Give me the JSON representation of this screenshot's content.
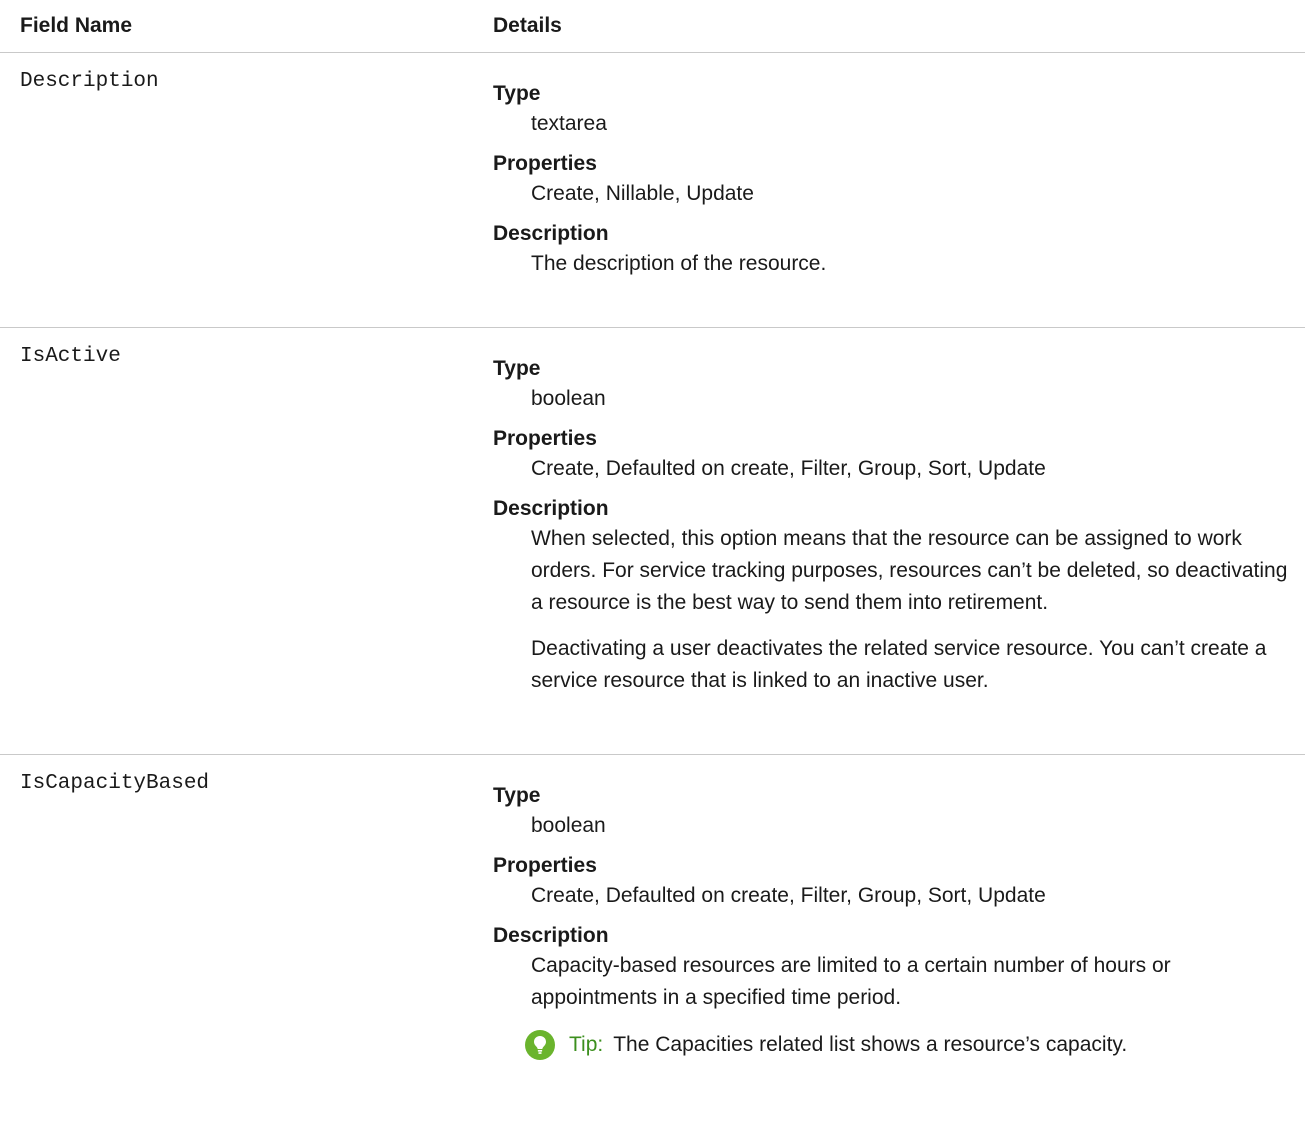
{
  "header": {
    "field_name": "Field Name",
    "details": "Details"
  },
  "rows": [
    {
      "name": "Description",
      "type_label": "Type",
      "type": "textarea",
      "properties_label": "Properties",
      "properties": "Create, Nillable, Update",
      "description_label": "Description",
      "description": [
        "The description of the resource."
      ]
    },
    {
      "name": "IsActive",
      "type_label": "Type",
      "type": "boolean",
      "properties_label": "Properties",
      "properties": "Create, Defaulted on create, Filter, Group, Sort, Update",
      "description_label": "Description",
      "description": [
        "When selected, this option means that the resource can be assigned to work orders. For service tracking purposes, resources can’t be deleted, so deactivating a resource is the best way to send them into retirement.",
        "Deactivating a user deactivates the related service resource. You can’t create a service resource that is linked to an inactive user."
      ]
    },
    {
      "name": "IsCapacityBased",
      "type_label": "Type",
      "type": "boolean",
      "properties_label": "Properties",
      "properties": "Create, Defaulted on create, Filter, Group, Sort, Update",
      "description_label": "Description",
      "description": [
        "Capacity-based resources are limited to a certain number of hours or appointments in a specified time period."
      ],
      "tip": {
        "icon": "lightbulb-icon",
        "label": "Tip:",
        "text": "The Capacities related list shows a resource’s capacity."
      }
    }
  ],
  "colors": {
    "tip_icon": "#6ab42d",
    "tip_label": "#3c8f1e",
    "divider": "#c9c9c9"
  }
}
